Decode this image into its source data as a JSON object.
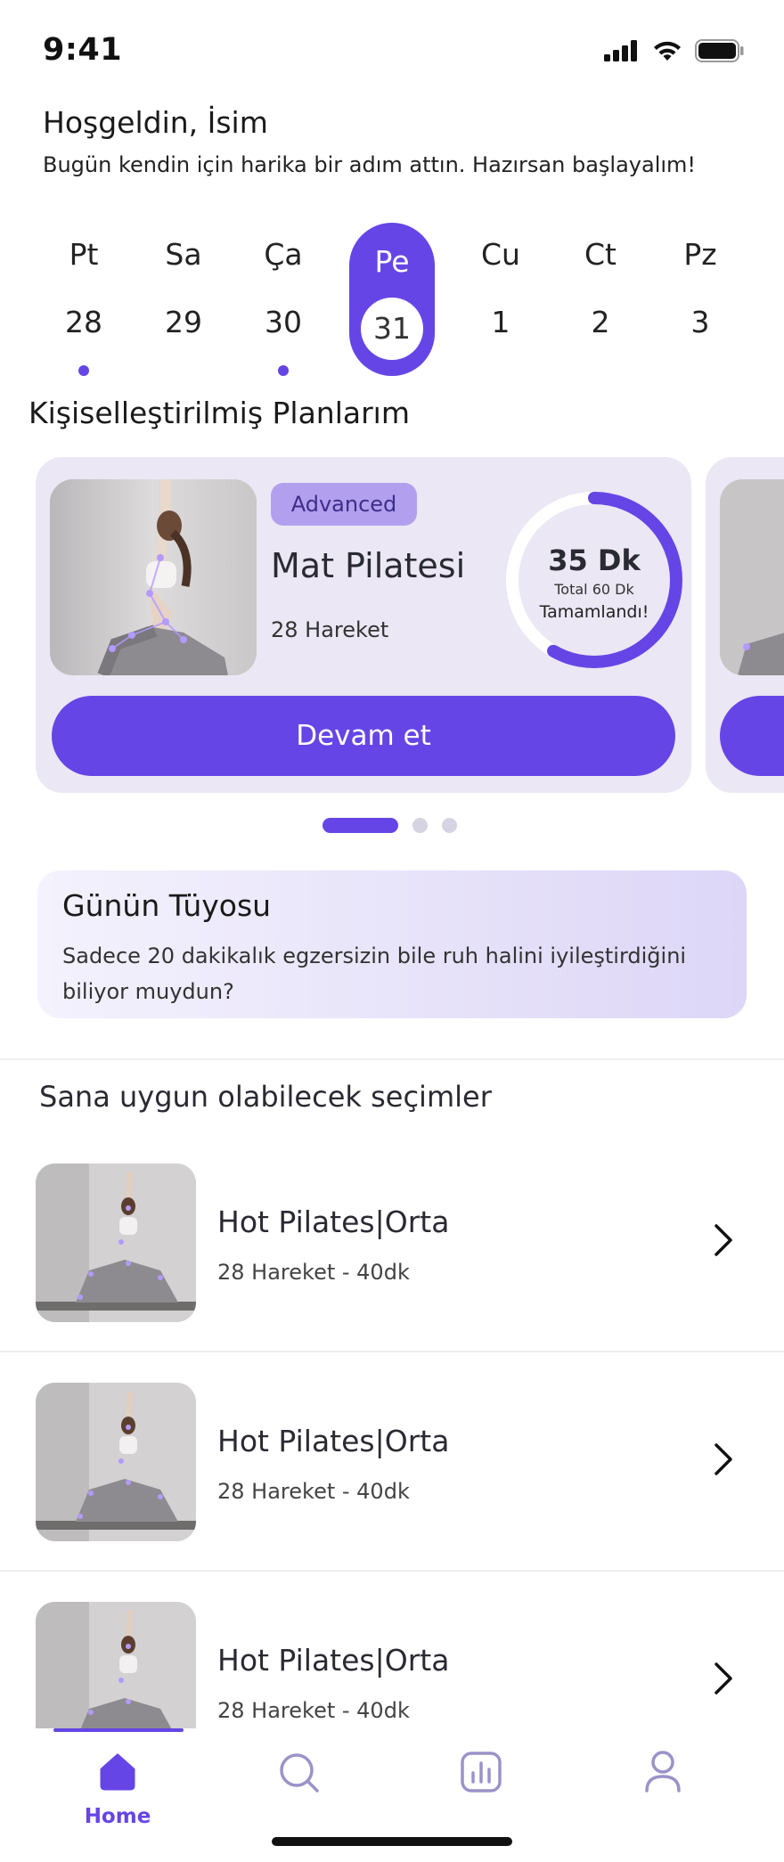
{
  "status_bar": {
    "time": "9:41"
  },
  "greeting": {
    "title": "Hoşgeldin, İsim",
    "subtitle": "Bugün kendin için harika bir adım attın. Hazırsan başlayalım!"
  },
  "calendar": {
    "days": [
      {
        "name": "Pt",
        "num": "28",
        "has_dot": true,
        "active": false
      },
      {
        "name": "Sa",
        "num": "29",
        "has_dot": false,
        "active": false
      },
      {
        "name": "Ça",
        "num": "30",
        "has_dot": true,
        "active": false
      },
      {
        "name": "Pe",
        "num": "31",
        "has_dot": false,
        "active": true
      },
      {
        "name": "Cu",
        "num": "1",
        "has_dot": false,
        "active": false
      },
      {
        "name": "Ct",
        "num": "2",
        "has_dot": false,
        "active": false
      },
      {
        "name": "Pz",
        "num": "3",
        "has_dot": false,
        "active": false
      }
    ],
    "accent_color": "#6645e6"
  },
  "plans": {
    "section_title": "Kişiselleştirilmiş Planlarım",
    "card": {
      "level": "Advanced",
      "name": "Mat Pilatesi",
      "moves": "28 Hareket",
      "progress_value": "35 Dk",
      "progress_total": "Total 60 Dk",
      "progress_label": "Tamamlandı!",
      "progress_fraction": 0.583,
      "button_label": "Devam et"
    },
    "pagination": {
      "count": 3,
      "active_index": 0
    }
  },
  "tip": {
    "title": "Günün Tüyosu",
    "text": "Sadece 20 dakikalık egzersizin bile ruh halini iyileştirdiğini biliyor muydun?"
  },
  "recommendations": {
    "section_title": "Sana uygun olabilecek seçimler",
    "items": [
      {
        "title": "Hot Pilates|Orta",
        "meta": "28 Hareket - 40dk"
      },
      {
        "title": "Hot Pilates|Orta",
        "meta": "28 Hareket - 40dk"
      },
      {
        "title": "Hot Pilates|Orta",
        "meta": "28 Hareket - 40dk"
      }
    ]
  },
  "tabbar": {
    "items": [
      {
        "label": "Home",
        "icon": "home-icon",
        "active": true
      },
      {
        "label": "",
        "icon": "search-icon",
        "active": false
      },
      {
        "label": "",
        "icon": "stats-icon",
        "active": false
      },
      {
        "label": "",
        "icon": "profile-icon",
        "active": false
      }
    ]
  },
  "colors": {
    "accent": "#6645e6",
    "card_bg": "#ebe7f4",
    "badge_bg": "#b2a0ee",
    "icon_inactive": "#9a93c8"
  }
}
